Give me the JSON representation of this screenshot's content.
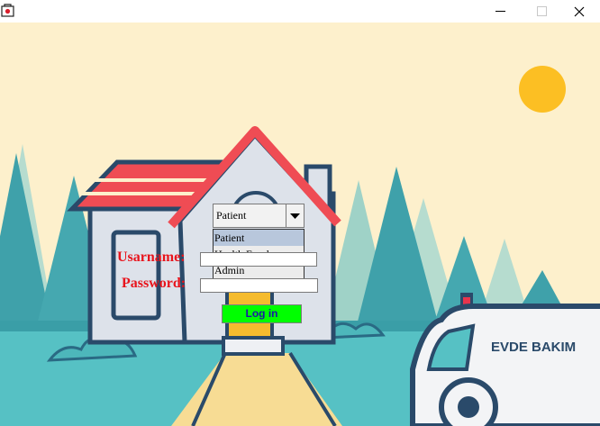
{
  "window": {
    "icon": "app-icon",
    "controls": {
      "minimize": "minimize-icon",
      "maximize": "maximize-icon",
      "close": "close-icon"
    }
  },
  "scene": {
    "ambulance_text": "EVDE BAKIM"
  },
  "form": {
    "role_select": {
      "value": "Patient",
      "options": [
        "Patient",
        "Health Employee",
        "Admin"
      ],
      "selected_index": 0
    },
    "username_label": "Usarname:",
    "username_value": "",
    "password_label": "Password:",
    "password_value": "",
    "login_label": "Log in"
  },
  "colors": {
    "label_red": "#e8141c",
    "login_green": "#00ff00",
    "login_text": "#1a1aa6",
    "sky": "#fdf0cc",
    "sun": "#fcbf23"
  }
}
